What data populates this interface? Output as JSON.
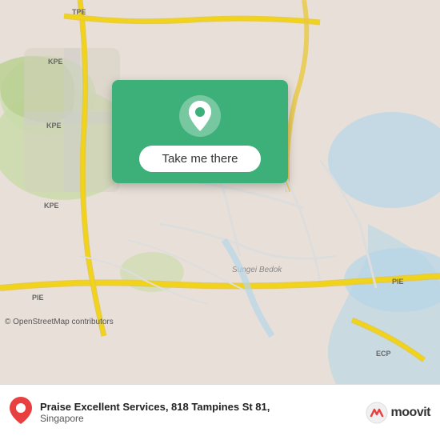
{
  "map": {
    "background_color": "#e8e0d8",
    "osm_attribution": "© OpenStreetMap contributors"
  },
  "card": {
    "button_label": "Take me there",
    "background_color": "#3daf78"
  },
  "bottom_bar": {
    "place_name": "Praise Excellent Services, 818 Tampines St 81,",
    "place_address": "Singapore",
    "moovit_label": "moovit"
  }
}
